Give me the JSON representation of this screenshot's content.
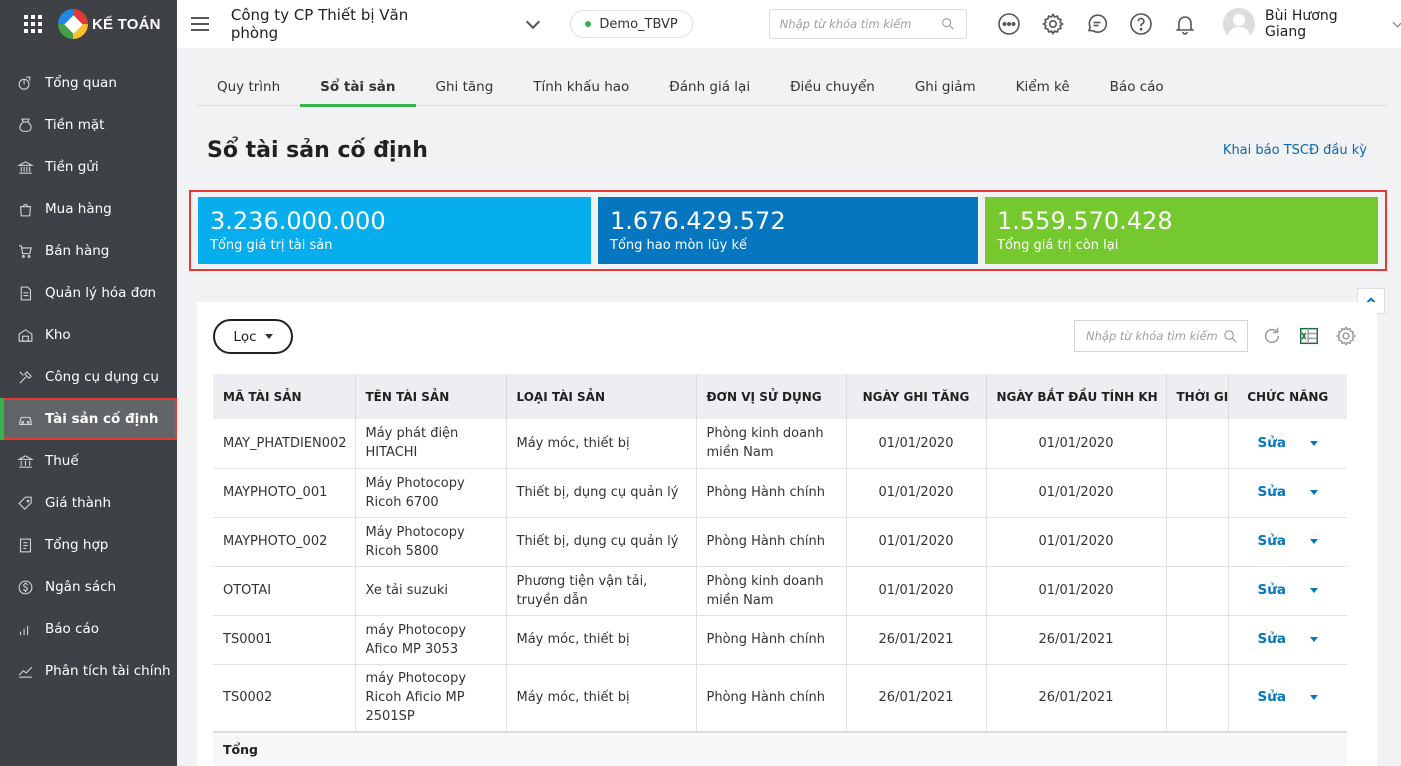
{
  "brand": {
    "name": "KẾ TOÁN"
  },
  "sidebar": {
    "items": [
      {
        "label": "Tổng quan",
        "icon": "dashboard-icon"
      },
      {
        "label": "Tiền mặt",
        "icon": "cash-bag-icon"
      },
      {
        "label": "Tiền gửi",
        "icon": "bank-icon"
      },
      {
        "label": "Mua hàng",
        "icon": "shopping-bag-icon"
      },
      {
        "label": "Bán hàng",
        "icon": "cart-icon"
      },
      {
        "label": "Quản lý hóa đơn",
        "icon": "invoice-icon"
      },
      {
        "label": "Kho",
        "icon": "warehouse-icon"
      },
      {
        "label": "Công cụ dụng cụ",
        "icon": "tools-icon"
      },
      {
        "label": "Tài sản cố định",
        "icon": "car-icon",
        "active": true
      },
      {
        "label": "Thuế",
        "icon": "tax-icon"
      },
      {
        "label": "Giá thành",
        "icon": "price-tag-icon"
      },
      {
        "label": "Tổng hợp",
        "icon": "ledger-icon"
      },
      {
        "label": "Ngân sách",
        "icon": "budget-icon"
      },
      {
        "label": "Báo cáo",
        "icon": "bar-chart-icon"
      },
      {
        "label": "Phân tích tài chính",
        "icon": "trend-icon"
      }
    ]
  },
  "topbar": {
    "company": "Công ty CP Thiết bị Văn phòng",
    "database": "Demo_TBVP",
    "search_placeholder": "Nhập từ khóa tìm kiếm",
    "user_name": "Bùi Hương Giang"
  },
  "tabs": [
    {
      "label": "Quy trình"
    },
    {
      "label": "Sổ tài sản",
      "active": true
    },
    {
      "label": "Ghi tăng"
    },
    {
      "label": "Tính khấu hao"
    },
    {
      "label": "Đánh giá lại"
    },
    {
      "label": "Điều chuyển"
    },
    {
      "label": "Ghi giảm"
    },
    {
      "label": "Kiểm kê"
    },
    {
      "label": "Báo cáo"
    }
  ],
  "page": {
    "title": "Sổ tài sản cố định",
    "declare_link": "Khai báo TSCĐ đầu kỳ"
  },
  "summary": [
    {
      "value": "3.236.000.000",
      "label": "Tổng giá trị tài sản",
      "color": "#06aeee"
    },
    {
      "value": "1.676.429.572",
      "label": "Tổng hao mòn lũy kế",
      "color": "#0576c0"
    },
    {
      "value": "1.559.570.428",
      "label": "Tổng giá trị còn lại",
      "color": "#75c82e"
    }
  ],
  "toolbar": {
    "filter_label": "Lọc",
    "search_placeholder": "Nhập từ khóa tìm kiếm"
  },
  "table": {
    "headers": {
      "code": "MÃ TÀI SẢN",
      "name": "TÊN TÀI SẢN",
      "type": "LOẠI TÀI SẢN",
      "unit": "ĐƠN VỊ SỬ DỤNG",
      "increase_date": "NGÀY GHI TĂNG",
      "depreciation_start": "NGÀY BẮT ĐẦU TÍNH KH",
      "duration": "THỜI GIAN",
      "actions": "CHỨC NĂNG"
    },
    "rows": [
      {
        "code": "MAY_PHATDIEN002",
        "name": "Máy phát điện HITACHI",
        "type": "Máy móc, thiết bị",
        "unit": "Phòng kinh doanh miền Nam",
        "increase_date": "01/01/2020",
        "depreciation_start": "01/01/2020",
        "duration": "",
        "action": "Sửa"
      },
      {
        "code": "MAYPHOTO_001",
        "name": "Máy Photocopy Ricoh 6700",
        "type": "Thiết bị, dụng cụ quản lý",
        "unit": "Phòng Hành chính",
        "increase_date": "01/01/2020",
        "depreciation_start": "01/01/2020",
        "duration": "",
        "action": "Sửa"
      },
      {
        "code": "MAYPHOTO_002",
        "name": "Máy Photocopy Ricoh 5800",
        "type": "Thiết bị, dụng cụ quản lý",
        "unit": "Phòng Hành chính",
        "increase_date": "01/01/2020",
        "depreciation_start": "01/01/2020",
        "duration": "",
        "action": "Sửa"
      },
      {
        "code": "OTOTAI",
        "name": "Xe tải suzuki",
        "type": "Phương tiện vận tải, truyền dẫn",
        "unit": "Phòng kinh doanh miền Nam",
        "increase_date": "01/01/2020",
        "depreciation_start": "01/01/2020",
        "duration": "",
        "action": "Sửa"
      },
      {
        "code": "TS0001",
        "name": "máy Photocopy Afico MP 3053",
        "type": "Máy móc, thiết bị",
        "unit": "Phòng Hành chính",
        "increase_date": "26/01/2021",
        "depreciation_start": "26/01/2021",
        "duration": "",
        "action": "Sửa"
      },
      {
        "code": "TS0002",
        "name": "máy Photocopy Ricoh Aficio MP 2501SP",
        "type": "Máy móc, thiết bị",
        "unit": "Phòng Hành chính",
        "increase_date": "26/01/2021",
        "depreciation_start": "26/01/2021",
        "duration": "",
        "action": "Sửa"
      }
    ],
    "footer_label": "Tổng"
  }
}
